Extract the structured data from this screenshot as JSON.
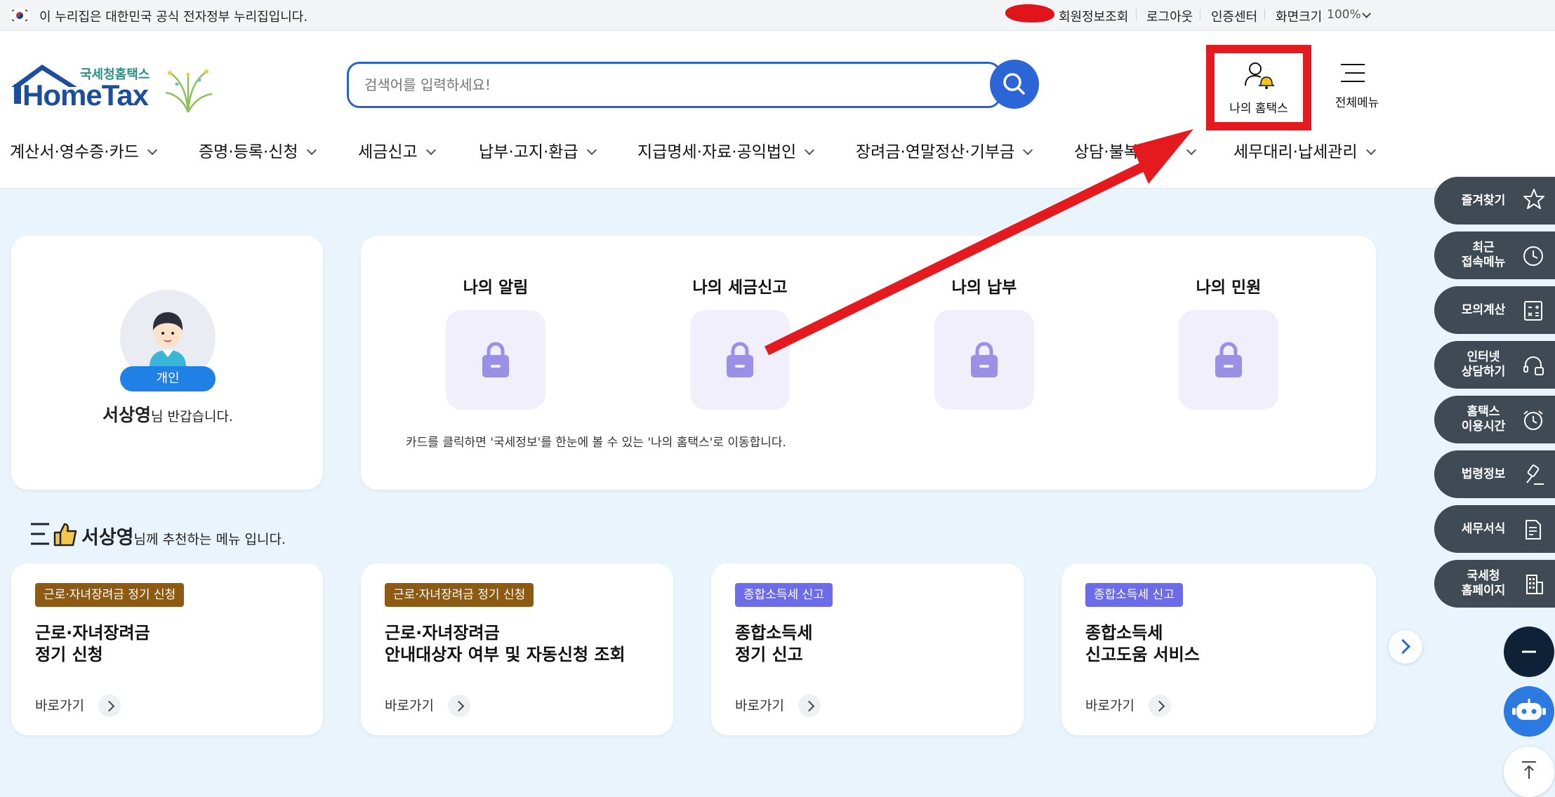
{
  "topbar": {
    "gov_notice": "이 누리집은 대한민국 공식 전자정부 누리집입니다.",
    "links": [
      "회원정보조회",
      "로그아웃",
      "인증센터",
      "화면크기"
    ],
    "zoom": "100%"
  },
  "header": {
    "logo_small": "국세청홈택스",
    "logo_main": "HomeTax",
    "search_placeholder": "검색어를 입력하세요!",
    "my_hometax": "나의 홈택스",
    "all_menu": "전체메뉴"
  },
  "gnb": [
    "계산서·영수증·카드",
    "증명·등록·신청",
    "세금신고",
    "납부·고지·환급",
    "지급명세·자료·공익법인",
    "장려금·연말정산·기부금",
    "상담·불복",
    "세무대리·납세관리"
  ],
  "profile": {
    "badge": "개인",
    "name": "서상영",
    "greeting": "님 반갑습니다."
  },
  "quick": {
    "items": [
      "나의 알림",
      "나의 세금신고",
      "나의 납부",
      "나의 민원"
    ],
    "hint": "카드를 클릭하면 '국세정보'를 한눈에 볼 수 있는 '나의 홈택스'로 이동합니다."
  },
  "recommend": {
    "name": "서상영",
    "suffix": "님께 추천하는 메뉴 입니다.",
    "link_label": "바로가기",
    "cards": [
      {
        "tag": "근로·자녀장려금 정기 신청",
        "line1": "근로·자녀장려금",
        "line2": "정기 신청"
      },
      {
        "tag": "근로·자녀장려금 정기 신청",
        "line1": "근로·자녀장려금",
        "line2": "안내대상자 여부 및 자동신청 조회"
      },
      {
        "tag": "종합소득세 신고",
        "line1": "종합소득세",
        "line2": "정기 신고"
      },
      {
        "tag": "종합소득세 신고",
        "line1": "종합소득세",
        "line2": "신고도움 서비스"
      }
    ]
  },
  "side": [
    {
      "l1": "즐겨찾기",
      "l2": "",
      "icon": "star-icon"
    },
    {
      "l1": "최근",
      "l2": "접속메뉴",
      "icon": "clock-icon"
    },
    {
      "l1": "모의계산",
      "l2": "",
      "icon": "calculator-icon"
    },
    {
      "l1": "인터넷",
      "l2": "상담하기",
      "icon": "headset-icon"
    },
    {
      "l1": "홈택스",
      "l2": "이용시간",
      "icon": "alarm-clock-icon"
    },
    {
      "l1": "법령정보",
      "l2": "",
      "icon": "gavel-icon"
    },
    {
      "l1": "세무서식",
      "l2": "",
      "icon": "document-icon"
    },
    {
      "l1": "국세청",
      "l2": "홈페이지",
      "icon": "building-icon"
    }
  ],
  "colors": {
    "accent": "#2c66d6",
    "annotation": "#e51a1f",
    "tag_brown": "#8c5a12",
    "tag_purple": "#6c6ce8",
    "side_dark": "#3f4a55"
  }
}
